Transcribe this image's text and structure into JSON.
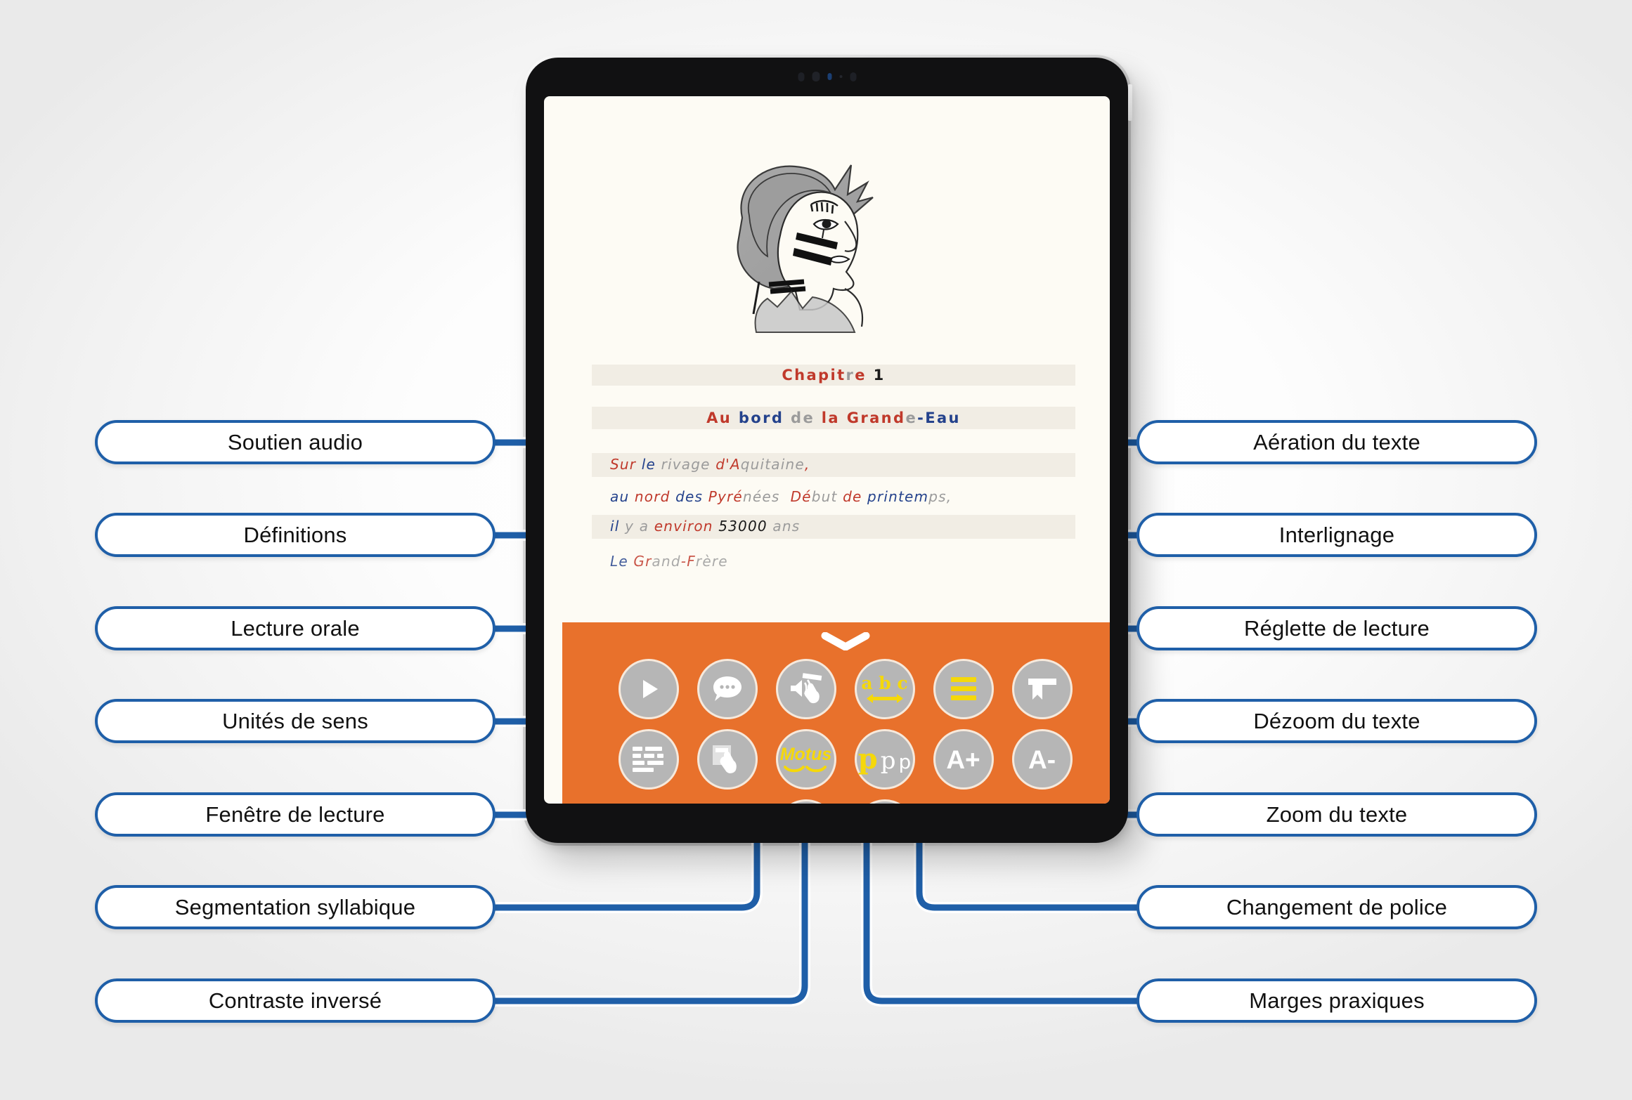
{
  "device": {
    "name": "tablet",
    "sensors": [
      "proximity-sensor",
      "camera",
      "indicator-light",
      "mic"
    ]
  },
  "reader": {
    "illustration_alt": "profil d'un visage dessiné au trait",
    "chapter_line": "Chapitre 1",
    "title_line": "Au bord de la Grande-Eau",
    "body_lines": [
      "Sur le rivage d'Aquitaine,",
      "au nord des Pyrénées  Début de printemps,",
      "il y a environ 53000 ans"
    ],
    "hidden_line": "Le Grand-Frère"
  },
  "toolbar": {
    "collapse_handle": "chevron-down",
    "rows": [
      [
        {
          "id": "play",
          "icon": "play-icon",
          "label": "Lecture orale"
        },
        {
          "id": "definitions",
          "icon": "speech-bubble-icon",
          "label": "Définitions"
        },
        {
          "id": "audio",
          "icon": "speaker-tap-icon",
          "label": "Soutien audio"
        },
        {
          "id": "aeration",
          "icon": "abc-spacing-icon",
          "label": "Aération du texte",
          "text": "a b c"
        },
        {
          "id": "linespacing",
          "icon": "line-spacing-icon",
          "label": "Interlignage"
        },
        {
          "id": "ruler",
          "icon": "reading-ruler-icon",
          "label": "Réglette de lecture"
        }
      ],
      [
        {
          "id": "units",
          "icon": "text-blocks-icon",
          "label": "Unités de sens"
        },
        {
          "id": "window",
          "icon": "reading-window-icon",
          "label": "Fenêtre de lecture"
        },
        {
          "id": "syllables",
          "icon": "motus-icon",
          "label": "Segmentation syllabique",
          "text": "Motus"
        },
        {
          "id": "font",
          "icon": "font-change-icon",
          "label": "Changement de police",
          "text": "p p p"
        },
        {
          "id": "zoomin",
          "icon": "text-larger-icon",
          "label": "Zoom du texte",
          "text": "A+"
        },
        {
          "id": "zoomout",
          "icon": "text-smaller-icon",
          "label": "Dézoom du texte",
          "text": "A-"
        }
      ],
      [
        {
          "id": "contrast",
          "icon": "moon-icon",
          "label": "Contraste inversé"
        },
        {
          "id": "margins",
          "icon": "margins-icon",
          "label": "Marges praxiques"
        }
      ]
    ]
  },
  "callouts": {
    "left": [
      {
        "text": "Soutien audio"
      },
      {
        "text": "Définitions"
      },
      {
        "text": "Lecture orale"
      },
      {
        "text": "Unités de sens"
      },
      {
        "text": "Fenêtre de lecture"
      },
      {
        "text": "Segmentation syllabique"
      },
      {
        "text": "Contraste inversé"
      }
    ],
    "right": [
      {
        "text": "Aération du texte"
      },
      {
        "text": "Interlignage"
      },
      {
        "text": "Réglette de lecture"
      },
      {
        "text": "Dézoom du texte"
      },
      {
        "text": "Zoom du texte"
      },
      {
        "text": "Changement de police"
      },
      {
        "text": "Marges praxiques"
      }
    ]
  },
  "colors": {
    "accent_orange": "#e8712c",
    "connector_blue": "#1f5fa8",
    "icon_grey": "#b6b6b6",
    "highlight_yellow": "#f5d80a",
    "page_cream": "#fdfbf4"
  }
}
